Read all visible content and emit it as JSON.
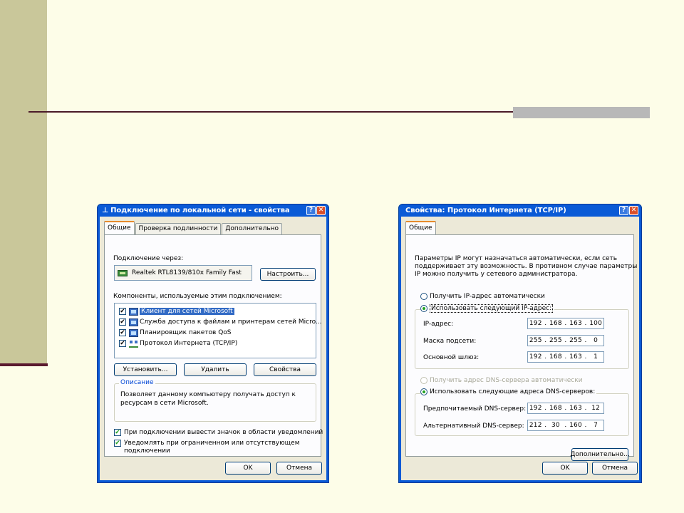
{
  "left_dialog": {
    "title": "Подключение по локальной сети - свойства",
    "help": "?",
    "close": "✕",
    "tabs": [
      "Общие",
      "Проверка подлинности",
      "Дополнительно"
    ],
    "connect_via_label": "Подключение через:",
    "adapter": "Realtek RTL8139/810x Family Fast",
    "configure_button": "Настроить...",
    "components_label": "Компоненты, используемые этим подключением:",
    "components": [
      {
        "label": "Клиент для сетей Microsoft",
        "checked": true,
        "icon": "network-client-icon"
      },
      {
        "label": "Служба доступа к файлам и принтерам сетей Micro...",
        "checked": true,
        "icon": "file-printer-sharing-icon"
      },
      {
        "label": "Планировщик пакетов QoS",
        "checked": true,
        "icon": "qos-scheduler-icon"
      },
      {
        "label": "Протокол Интернета (TCP/IP)",
        "checked": true,
        "icon": "tcpip-protocol-icon"
      }
    ],
    "install_button": "Установить...",
    "remove_button": "Удалить",
    "properties_button": "Свойства",
    "description_legend": "Описание",
    "description_text_1": "Позволяет данному компьютеру получать доступ к",
    "description_text_2": "ресурсам в сети Microsoft.",
    "show_icon_label": "При подключении вывести значок в области уведомлений",
    "notify_label_1": "Уведомлять при ограниченном или отсутствующем",
    "notify_label_2": "подключении",
    "ok_button": "OK",
    "cancel_button": "Отмена"
  },
  "right_dialog": {
    "title": "Свойства: Протокол Интернета (TCP/IP)",
    "help": "?",
    "close": "✕",
    "tab": "Общие",
    "intro_1": "Параметры IP могут назначаться автоматически, если сеть",
    "intro_2": "поддерживает эту возможность. В противном случае параметры",
    "intro_3": "IP можно получить у сетевого администратора.",
    "auto_ip_label": "Получить IP-адрес автоматически",
    "manual_ip_label": "Использовать следующий IP-адрес:",
    "ip_label": "IP-адрес:",
    "ip_value": [
      "192",
      "168",
      "163",
      "100"
    ],
    "mask_label": "Маска подсети:",
    "mask_value": [
      "255",
      "255",
      "255",
      "0"
    ],
    "gateway_label": "Основной шлюз:",
    "gateway_value": [
      "192",
      "168",
      "163",
      "1"
    ],
    "auto_dns_label": "Получить адрес DNS-сервера автоматически",
    "manual_dns_label": "Использовать следующие адреса DNS-серверов:",
    "preferred_dns_label": "Предпочитаемый DNS-сервер:",
    "preferred_dns_value": [
      "192",
      "168",
      "163",
      "12"
    ],
    "alternate_dns_label": "Альтернативный DNS-сервер:",
    "alternate_dns_value": [
      "212",
      "30",
      "160",
      "7"
    ],
    "advanced_button": "Дополнительно...",
    "ok_button": "OK",
    "cancel_button": "Отмена"
  },
  "colors": {
    "titlebar": "#0a5ad6",
    "dialog_bg": "#ece9d8",
    "slide_bg": "#fdfde8",
    "side_bar": "#c9c79a",
    "rule": "#4a1a28"
  }
}
